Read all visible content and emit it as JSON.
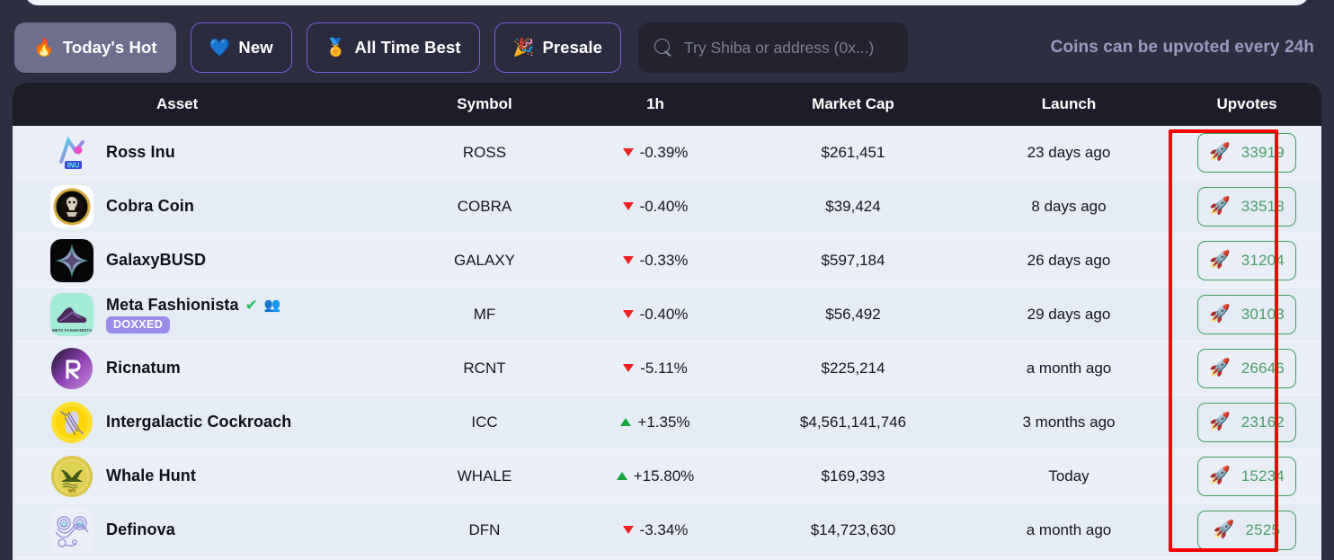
{
  "toolbar": {
    "filters": [
      {
        "label": "Today's Hot",
        "icon": "fire-icon",
        "glyph": "🔥",
        "active": true
      },
      {
        "label": "New",
        "icon": "blue-heart-icon",
        "glyph": "💙",
        "active": false
      },
      {
        "label": "All Time Best",
        "icon": "trophy-medal-icon",
        "glyph": "🏅",
        "active": false
      },
      {
        "label": "Presale",
        "icon": "party-popper-icon",
        "glyph": "🎉",
        "active": false
      }
    ],
    "search": {
      "value": "",
      "placeholder": "Try Shiba or address (0x...)",
      "icon": "search-icon"
    },
    "note": "Coins can be upvoted every 24h"
  },
  "table": {
    "columns": [
      "Asset",
      "Symbol",
      "1h",
      "Market Cap",
      "Launch",
      "Upvotes"
    ],
    "rows": [
      {
        "name": "Ross Inu",
        "symbol": "ROSS",
        "change": "-0.39%",
        "dir": "down",
        "market_cap": "$261,451",
        "launch": "23 days ago",
        "upvotes": "33919",
        "logo": "ross-inu-logo",
        "verified": false,
        "doxxed": false
      },
      {
        "name": "Cobra Coin",
        "symbol": "COBRA",
        "change": "-0.40%",
        "dir": "down",
        "market_cap": "$39,424",
        "launch": "8 days ago",
        "upvotes": "33518",
        "logo": "cobra-coin-logo",
        "verified": false,
        "doxxed": false
      },
      {
        "name": "GalaxyBUSD",
        "symbol": "GALAXY",
        "change": "-0.33%",
        "dir": "down",
        "market_cap": "$597,184",
        "launch": "26 days ago",
        "upvotes": "31204",
        "logo": "galaxybusd-logo",
        "verified": false,
        "doxxed": false
      },
      {
        "name": "Meta Fashionista",
        "symbol": "MF",
        "change": "-0.40%",
        "dir": "down",
        "market_cap": "$56,492",
        "launch": "29 days ago",
        "upvotes": "30103",
        "logo": "meta-fashionista-logo",
        "verified": true,
        "doxxed": true,
        "doxxed_label": "DOXXED"
      },
      {
        "name": "Ricnatum",
        "symbol": "RCNT",
        "change": "-5.11%",
        "dir": "down",
        "market_cap": "$225,214",
        "launch": "a month ago",
        "upvotes": "26646",
        "logo": "ricnatum-logo",
        "verified": false,
        "doxxed": false
      },
      {
        "name": "Intergalactic Cockroach",
        "symbol": "ICC",
        "change": "+1.35%",
        "dir": "up",
        "market_cap": "$4,561,141,746",
        "launch": "3 months ago",
        "upvotes": "23162",
        "logo": "intergalactic-cockroach-logo",
        "verified": false,
        "doxxed": false
      },
      {
        "name": "Whale Hunt",
        "symbol": "WHALE",
        "change": "+15.80%",
        "dir": "up",
        "market_cap": "$169,393",
        "launch": "Today",
        "upvotes": "15234",
        "logo": "whale-hunt-logo",
        "verified": false,
        "doxxed": false
      },
      {
        "name": "Definova",
        "symbol": "DFN",
        "change": "-3.34%",
        "dir": "down",
        "market_cap": "$14,723,630",
        "launch": "a month ago",
        "upvotes": "2525",
        "logo": "definova-logo",
        "verified": false,
        "doxxed": false
      }
    ]
  },
  "colors": {
    "page_background": "#2e2e43",
    "header_row": "#1c1d28",
    "row_background": "#e9eef7",
    "accent_purple": "#7b5ce0",
    "active_filter": "#6e6e8f",
    "positive": "#14a33c",
    "negative": "#f01f1f",
    "upvote_green": "#4a9c67",
    "doxxed_badge": "#9b8cec",
    "annotation_red": "#fe0000"
  }
}
